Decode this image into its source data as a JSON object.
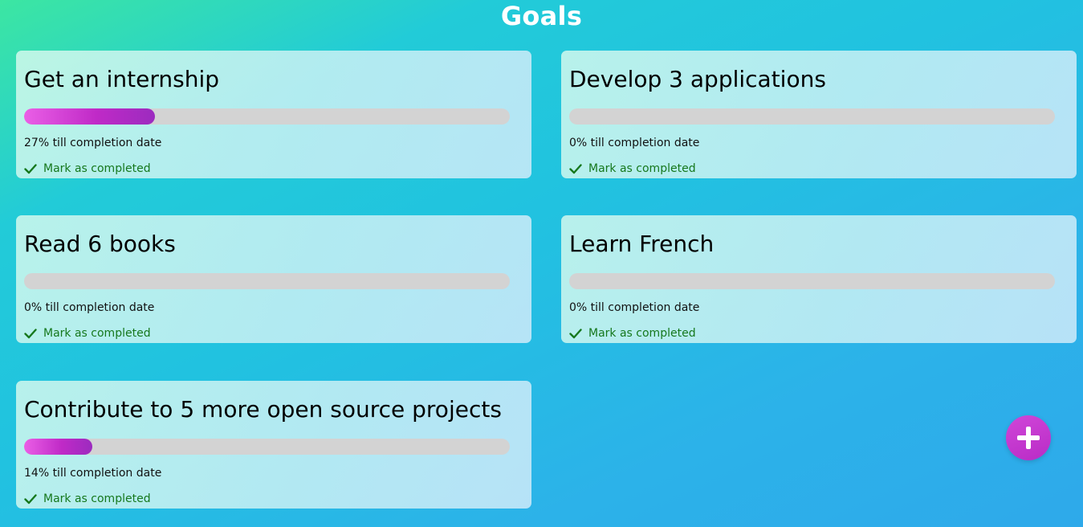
{
  "page": {
    "title": "Goals"
  },
  "goals": [
    {
      "title": "Get an internship",
      "progress_percent": 27,
      "progress_text": "27% till completion date",
      "complete_label": "Mark as completed"
    },
    {
      "title": "Develop 3 applications",
      "progress_percent": 0,
      "progress_text": "0% till completion date",
      "complete_label": "Mark as completed"
    },
    {
      "title": "Read 6 books",
      "progress_percent": 0,
      "progress_text": "0% till completion date",
      "complete_label": "Mark as completed"
    },
    {
      "title": "Learn French",
      "progress_percent": 0,
      "progress_text": "0% till completion date",
      "complete_label": "Mark as completed"
    },
    {
      "title": "Contribute to 5 more open source projects",
      "progress_percent": 14,
      "progress_text": "14% till completion date",
      "complete_label": "Mark as completed"
    }
  ],
  "icons": {
    "complete": "check-icon",
    "add": "plus-icon"
  },
  "colors": {
    "progress_fill_start": "#ea5fe6",
    "progress_fill_end": "#9c2bbf",
    "progress_track": "#d3d3d3",
    "complete_label": "#16781d",
    "add_button": "#c335cf"
  }
}
